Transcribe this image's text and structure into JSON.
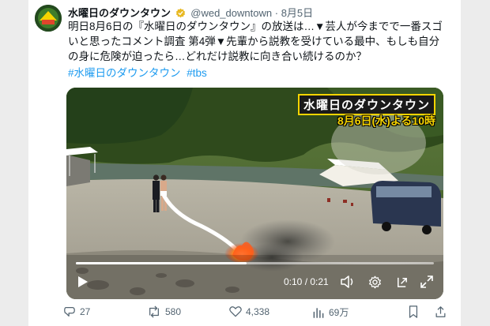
{
  "tweet": {
    "display_name": "水曜日のダウンタウン",
    "handle": "@wed_downtown",
    "separator": "·",
    "date": "8月5日",
    "text": "明日8月6日の『水曜日のダウンタウン』の放送は…▼芸人が今までで一番スゴいと思ったコメント調査 第4弾▼先輩から説教を受けている最中、もしも自分の身に危険が迫ったら…どれだけ説教に向き合い続けるのか？",
    "hashtags": [
      "#水曜日のダウンタウン",
      "#tbs"
    ]
  },
  "video": {
    "logo_title": "水曜日のダウンタウン",
    "air_time": "8月6日(水)よる10時",
    "time_display": "0:10 / 0:21",
    "progress": 0.476
  },
  "actions": {
    "replies": "27",
    "reposts": "580",
    "likes": "4,338",
    "views": "69万"
  },
  "colors": {
    "accent": "#1d9bf0",
    "text": "#0f1419",
    "muted": "#536471",
    "logo_yellow": "#f6d400"
  }
}
